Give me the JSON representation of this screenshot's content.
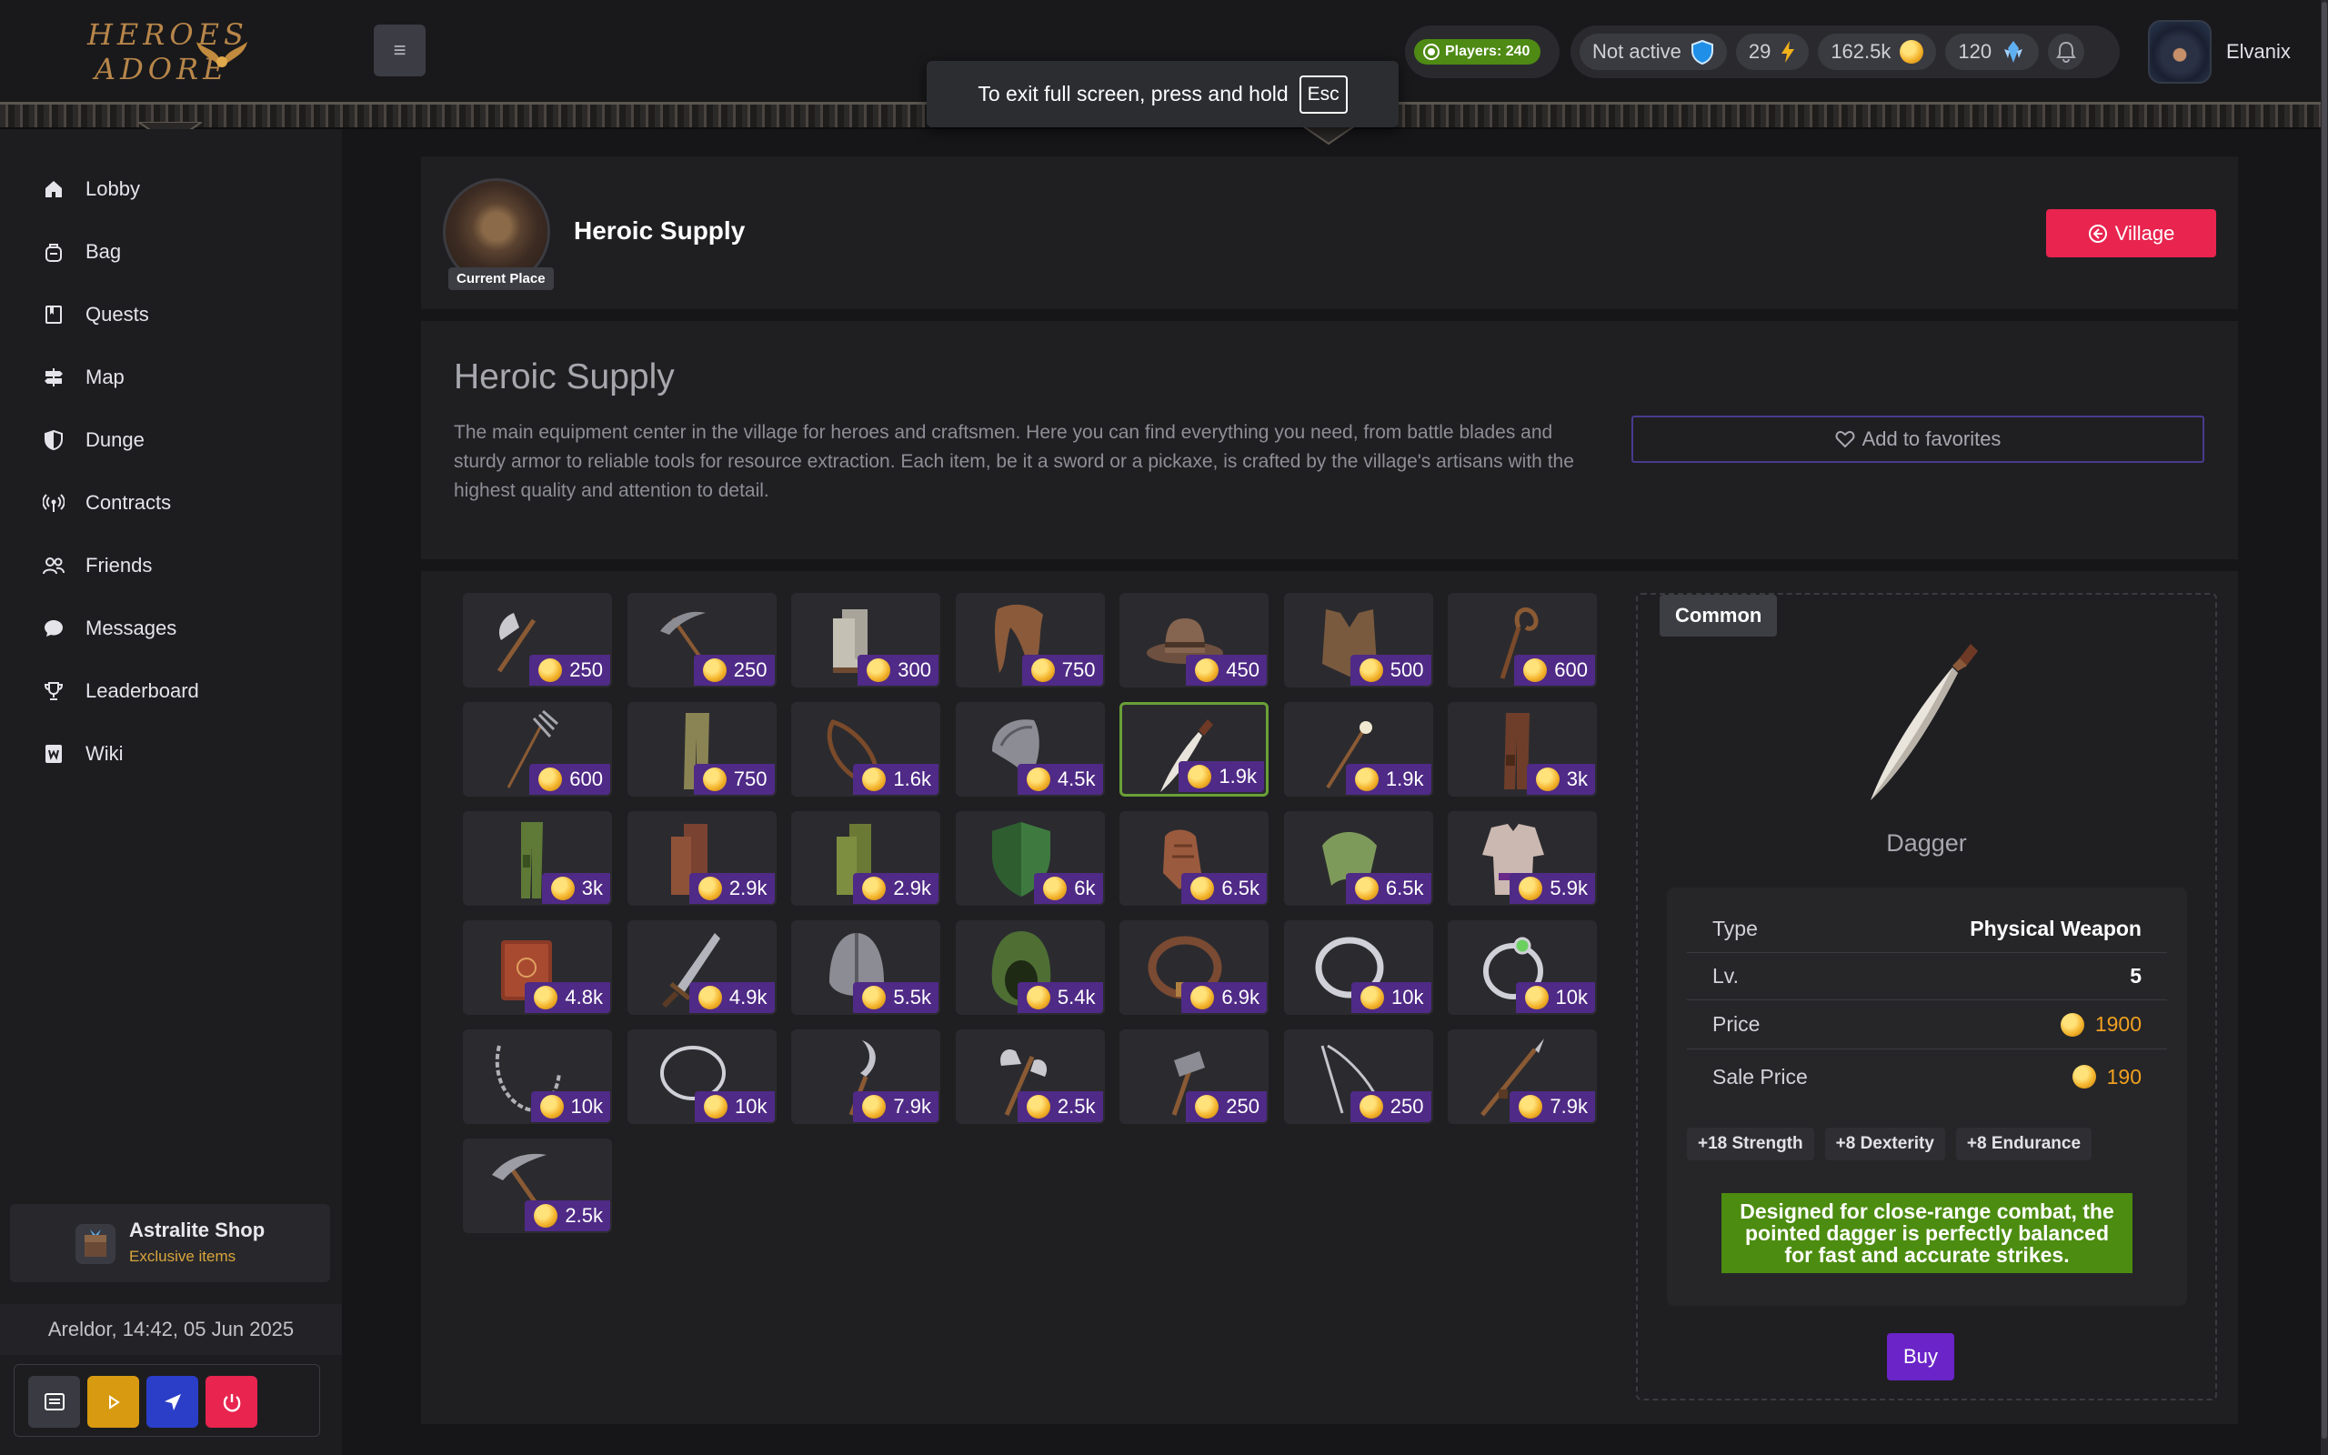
{
  "brand": {
    "line1": "HEROES",
    "line2": "ADORE",
    "icon": "golden-wings-emblem"
  },
  "header": {
    "menu_icon": "hamburger-icon",
    "fullscreen_notice": "To exit full screen, press and hold",
    "fullscreen_key": "Esc",
    "players": "Players: 240",
    "status_text": "Not active",
    "status_icon": "shield-icon",
    "energy": "29",
    "energy_icon": "lightning-icon",
    "gold": "162.5k",
    "gold_icon": "coin-icon",
    "astralite": "120",
    "astralite_icon": "crystal-icon",
    "bell_icon": "bell-icon",
    "username": "Elvanix",
    "colors": {
      "players_green": "#4e8a14"
    }
  },
  "sidebar": {
    "items": [
      {
        "label": "Lobby",
        "icon": "home-icon"
      },
      {
        "label": "Bag",
        "icon": "bag-icon"
      },
      {
        "label": "Quests",
        "icon": "quest-book-icon"
      },
      {
        "label": "Map",
        "icon": "signpost-icon"
      },
      {
        "label": "Dunge",
        "icon": "half-shield-icon"
      },
      {
        "label": "Contracts",
        "icon": "broadcast-icon"
      },
      {
        "label": "Friends",
        "icon": "people-icon"
      },
      {
        "label": "Messages",
        "icon": "chat-bubble-icon"
      },
      {
        "label": "Leaderboard",
        "icon": "trophy-icon"
      },
      {
        "label": "Wiki",
        "icon": "wiki-icon"
      }
    ],
    "shop": {
      "title": "Astralite Shop",
      "subtitle": "Exclusive items"
    },
    "datetime": "Areldor, 14:42, 05 Jun 2025",
    "controls": [
      {
        "icon": "chat-log-icon",
        "color": "#3a3a42"
      },
      {
        "icon": "play-icon",
        "color": "#d89a10"
      },
      {
        "icon": "send-icon",
        "color": "#2a3ec8"
      },
      {
        "icon": "power-icon",
        "color": "#e8244f"
      }
    ]
  },
  "place": {
    "title": "Heroic Supply",
    "badge": "Current Place",
    "village_button": "Village",
    "village_icon": "back-arrow-circle-icon"
  },
  "description": {
    "title": "Heroic Supply",
    "text": "The main equipment center in the village for heroes and craftsmen. Here you can find everything you need, from battle blades and sturdy armor to reliable tools for resource extraction. Each item, be it a sword or a pickaxe, is crafted by the village's artisans with the highest quality and attention to detail.",
    "favorite_button": "Add to favorites",
    "favorite_icon": "heart-icon"
  },
  "items": [
    {
      "price": "250",
      "icon": "axe-icon"
    },
    {
      "price": "250",
      "icon": "pickaxe-icon"
    },
    {
      "price": "300",
      "icon": "boots-icon"
    },
    {
      "price": "750",
      "icon": "scarf-icon"
    },
    {
      "price": "450",
      "icon": "hat-icon"
    },
    {
      "price": "500",
      "icon": "vest-icon"
    },
    {
      "price": "600",
      "icon": "staff-icon"
    },
    {
      "price": "600",
      "icon": "pitchfork-icon"
    },
    {
      "price": "750",
      "icon": "pants-icon"
    },
    {
      "price": "1.6k",
      "icon": "sling-icon"
    },
    {
      "price": "4.5k",
      "icon": "shoulder-guard-icon"
    },
    {
      "price": "1.9k",
      "icon": "dagger-icon",
      "selected": true
    },
    {
      "price": "1.9k",
      "icon": "wand-icon"
    },
    {
      "price": "3k",
      "icon": "leather-pants-icon"
    },
    {
      "price": "3k",
      "icon": "green-pants-icon"
    },
    {
      "price": "2.9k",
      "icon": "leather-boots-icon"
    },
    {
      "price": "2.9k",
      "icon": "green-boots-icon"
    },
    {
      "price": "6k",
      "icon": "green-shield-icon"
    },
    {
      "price": "6.5k",
      "icon": "gauntlets-icon"
    },
    {
      "price": "6.5k",
      "icon": "mantle-icon"
    },
    {
      "price": "5.9k",
      "icon": "tunic-icon"
    },
    {
      "price": "4.8k",
      "icon": "spellbook-icon"
    },
    {
      "price": "4.9k",
      "icon": "sword-icon"
    },
    {
      "price": "5.5k",
      "icon": "helmet-icon"
    },
    {
      "price": "5.4k",
      "icon": "hood-icon"
    },
    {
      "price": "6.9k",
      "icon": "belt-icon"
    },
    {
      "price": "10k",
      "icon": "ring-icon"
    },
    {
      "price": "10k",
      "icon": "gem-ring-icon"
    },
    {
      "price": "10k",
      "icon": "chain-necklace-icon"
    },
    {
      "price": "10k",
      "icon": "cord-necklace-icon"
    },
    {
      "price": "7.9k",
      "icon": "sickle-icon"
    },
    {
      "price": "2.5k",
      "icon": "double-axe-icon"
    },
    {
      "price": "250",
      "icon": "hammer-icon"
    },
    {
      "price": "250",
      "icon": "fishing-line-icon"
    },
    {
      "price": "7.9k",
      "icon": "spear-icon"
    },
    {
      "price": "2.5k",
      "icon": "iron-pickaxe-icon"
    }
  ],
  "detail": {
    "rarity": "Common",
    "name": "Dagger",
    "icon": "dagger-icon",
    "type_label": "Type",
    "type_value": "Physical Weapon",
    "level_label": "Lv.",
    "level_value": "5",
    "price_label": "Price",
    "price_value": "1900",
    "sale_label": "Sale Price",
    "sale_value": "190",
    "bonuses": [
      "+18 Strength",
      "+8 Dexterity",
      "+8 Endurance"
    ],
    "lore": "Designed for close-range combat, the pointed dagger is perfectly balanced for fast and accurate strikes.",
    "buy_button": "Buy",
    "colors": {
      "lore_bg": "#4c8c10",
      "buy_bg": "#6a24c8",
      "gold_text": "#f0a020"
    }
  }
}
